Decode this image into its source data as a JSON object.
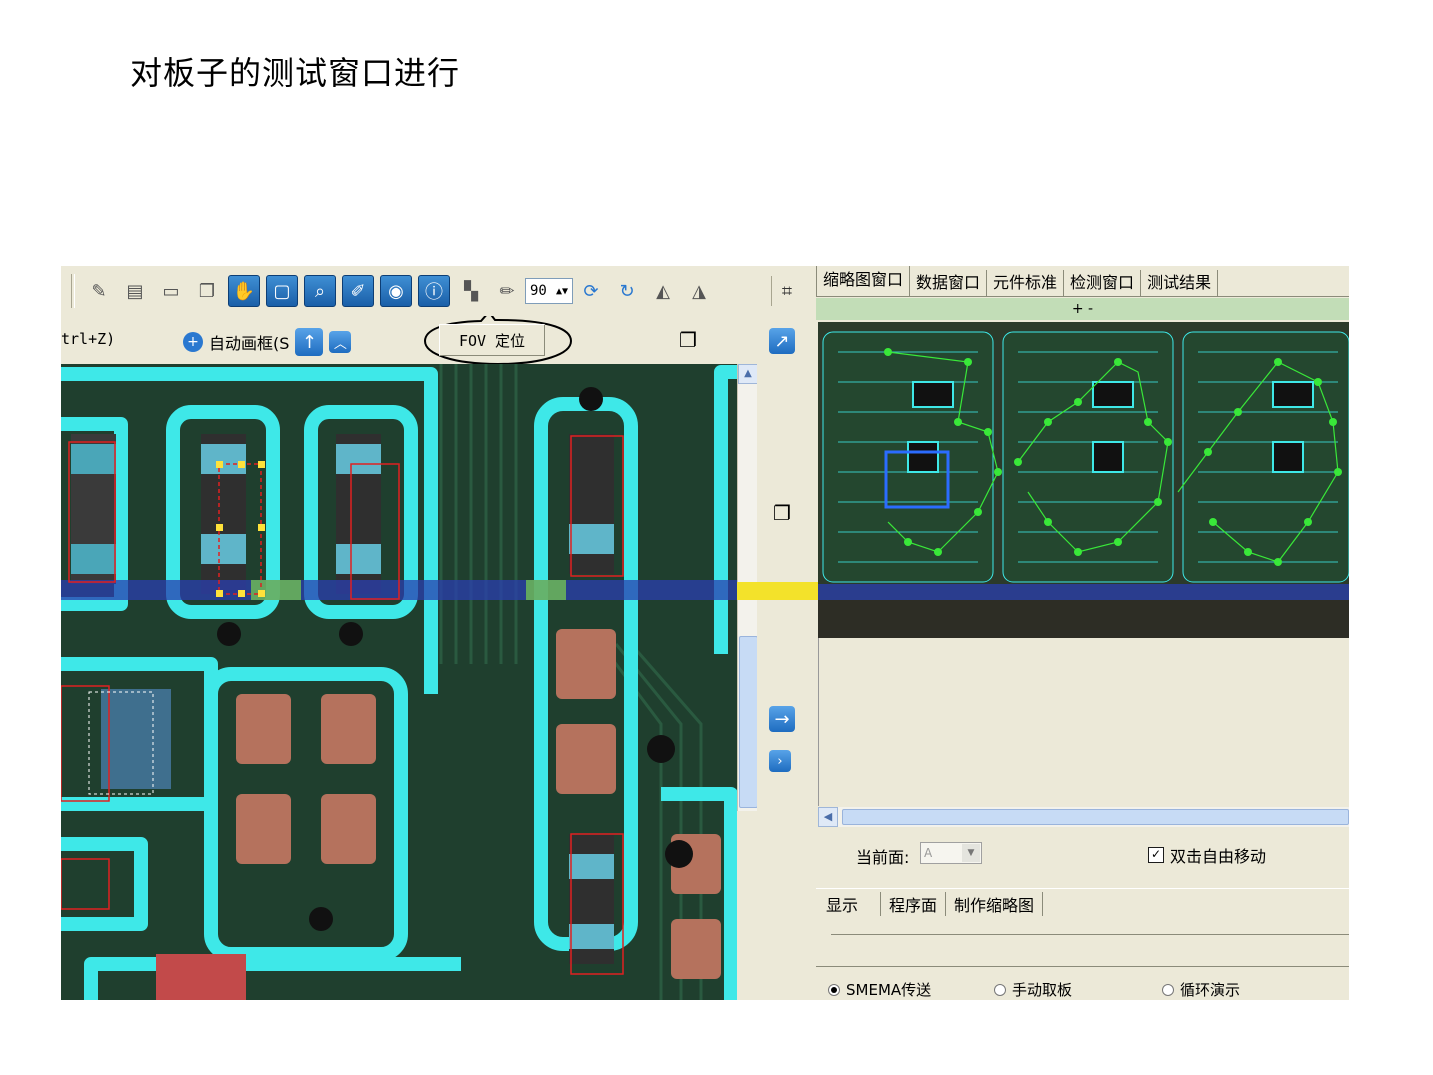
{
  "slide": {
    "title": "对板子的测试窗口进行"
  },
  "toolbar": {
    "zoom_value": "90",
    "icons": [
      "new-icon",
      "open-icon",
      "save-icon",
      "save-as-icon",
      "hand-icon",
      "frame-icon",
      "zoom-icon",
      "edit-icon",
      "camera-icon",
      "info-icon",
      "contrast-icon",
      "pencil-icon",
      "spinner",
      "refresh-icon",
      "rotate-icon",
      "mirror-left-icon",
      "mirror-right-icon",
      "fit-icon"
    ]
  },
  "subbar": {
    "undo_hint": "trl+Z)",
    "auto_frame_label": "自动画框(S",
    "fov_button": "FOV 定位"
  },
  "right_panel": {
    "tabs": [
      "缩略图窗口",
      "数据窗口",
      "元件标准",
      "检测窗口",
      "测试结果"
    ],
    "zoom_controls": "+ -",
    "current_face_label": "当前面:",
    "current_face_value": "A",
    "double_click_label": "双击自由移动",
    "double_click_checked": true,
    "lower_tabs": [
      "显示",
      "程序面",
      "制作缩略图"
    ],
    "transfer_options": [
      {
        "label": "SMEMA传送",
        "selected": true
      },
      {
        "label": "手动取板",
        "selected": false
      },
      {
        "label": "循环演示",
        "selected": false
      }
    ]
  },
  "colors": {
    "pad_cyan": "#3ee8e8",
    "board_green": "#1f3f2e",
    "copper": "#b5725d",
    "inspect_red": "#e02020",
    "window_bg": "#ece9d8",
    "thumbnail_strip": "#c2ddb7"
  }
}
